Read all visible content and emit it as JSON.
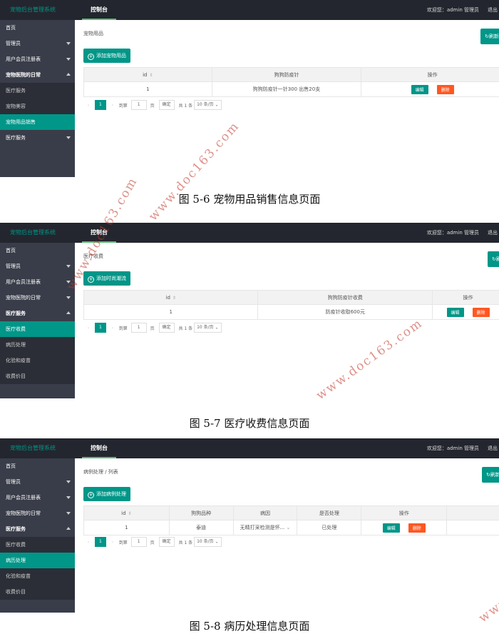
{
  "common": {
    "brand": "宠物后台管理系统",
    "top_tab": "控制台",
    "welcome": "欢迎您：admin 管理员",
    "logout": "退出",
    "refresh_label": "刷新",
    "pager": {
      "current": "1",
      "goto_label": "到第",
      "page_input": "1",
      "page_unit": "页",
      "confirm": "确定",
      "total": "共 1 条",
      "per_page": "10 条/页"
    },
    "edit": "编辑",
    "delete": "删除",
    "watermark": "www.doc163.com"
  },
  "shot1": {
    "sidebar": [
      "首页",
      "管理员",
      "用户会员注册表",
      "宠物医院的日常",
      "医疗服务",
      "宠物美容",
      "宠物用品销售",
      "医疗服务"
    ],
    "crumb": "宠物用品",
    "add_button": "添加宠物用品",
    "columns": [
      "id",
      "狗狗防疫针",
      "操作"
    ],
    "row": {
      "id": "1",
      "value": "狗狗防疫针一针300 出售20支"
    },
    "caption": "图 5-6 宠物用品销售信息页面"
  },
  "shot2": {
    "sidebar": [
      "首页",
      "管理员",
      "用户会员注册表",
      "宠物医院的日常",
      "医疗服务",
      "医疗收费",
      "病历处理",
      "化验和疫苗",
      "收费价目"
    ],
    "crumb": "医疗收费",
    "add_button": "添加时尚潮流",
    "columns": [
      "id",
      "狗狗防疫针收费",
      "操作"
    ],
    "row": {
      "id": "1",
      "value": "防疫针收取600元"
    },
    "caption": "图 5-7 医疗收费信息页面"
  },
  "shot3": {
    "sidebar": [
      "首页",
      "管理员",
      "用户会员注册表",
      "宠物医院的日常",
      "医疗服务",
      "医疗收费",
      "病历处理",
      "化验和疫苗",
      "收费价目"
    ],
    "crumb": "病例处理 / 列表",
    "add_button": "添加病例处理",
    "columns": [
      "id",
      "狗狗品种",
      "病因",
      "是否处理",
      "操作"
    ],
    "row": {
      "id": "1",
      "breed": "泰迪",
      "cause": "无精打采检测是怀...",
      "handled": "已处理"
    },
    "caption": "图 5-8 病历处理信息页面"
  },
  "colors": {
    "accent": "#009688",
    "danger": "#ff5722",
    "sidebar": "#393d49",
    "topbar": "#23262e"
  }
}
